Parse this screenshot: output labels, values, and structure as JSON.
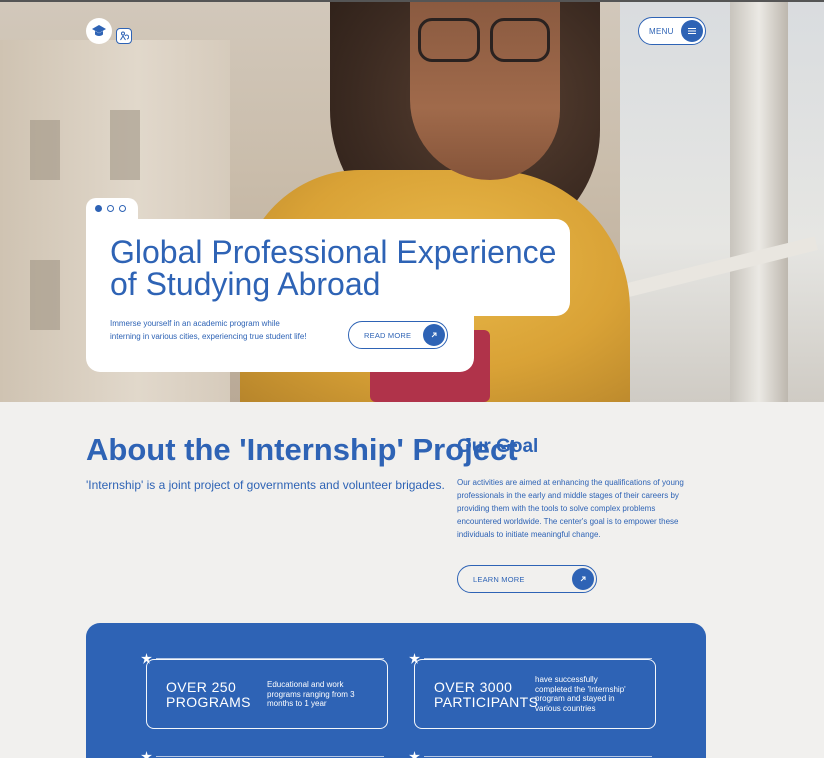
{
  "header": {
    "logo_icon": "graduation-cap-icon",
    "badge_icon": "accessibility-icon",
    "menu_label": "MENU",
    "menu_icon": "hamburger-icon"
  },
  "hero": {
    "slides": 3,
    "active_slide": 1,
    "title": "Global Professional Experience of Studying Abroad",
    "description": "Immerse yourself in an academic program while interning in various cities, experiencing true student life!",
    "read_more_label": "READ MORE"
  },
  "about": {
    "title": "About the 'Internship' Project",
    "subtitle": "'Internship' is a joint project of governments and volunteer brigades."
  },
  "goal": {
    "title": "Our Goal",
    "description": "Our activities are aimed at enhancing the qualifications of young professionals in the early and middle stages of their careers by providing them with the tools to solve complex problems encountered worldwide. The center's goal is to empower these individuals to initiate meaningful change.",
    "learn_more_label": "LEARN MORE"
  },
  "stats": {
    "items": [
      {
        "number": "OVER 250 PROGRAMS",
        "text": "Educational and work programs ranging from 3 months to 1 year"
      },
      {
        "number": "OVER 3000 PARTICIPANTS",
        "text": "have successfully completed the 'Internship' program and stayed in various countries"
      }
    ]
  },
  "colors": {
    "accent": "#2e63b5",
    "background": "#f1f0ee",
    "panel": "#ffffff"
  }
}
